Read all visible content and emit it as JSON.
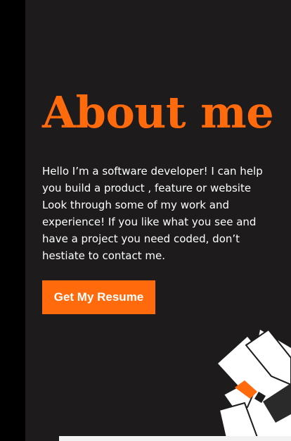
{
  "about": {
    "title": "About me",
    "intro": "Hello I’m a software developer! I can help you build a product , feature or website Look through some of my work and experience! If you like what you see and have a project you need coded, don’t hestiate to contact me.",
    "resume_button_label": "Get My Resume"
  },
  "colors": {
    "accent": "#ff6a0d",
    "panel_background": "#1d1b1b",
    "page_background": "#000000",
    "text": "#ffffff"
  }
}
